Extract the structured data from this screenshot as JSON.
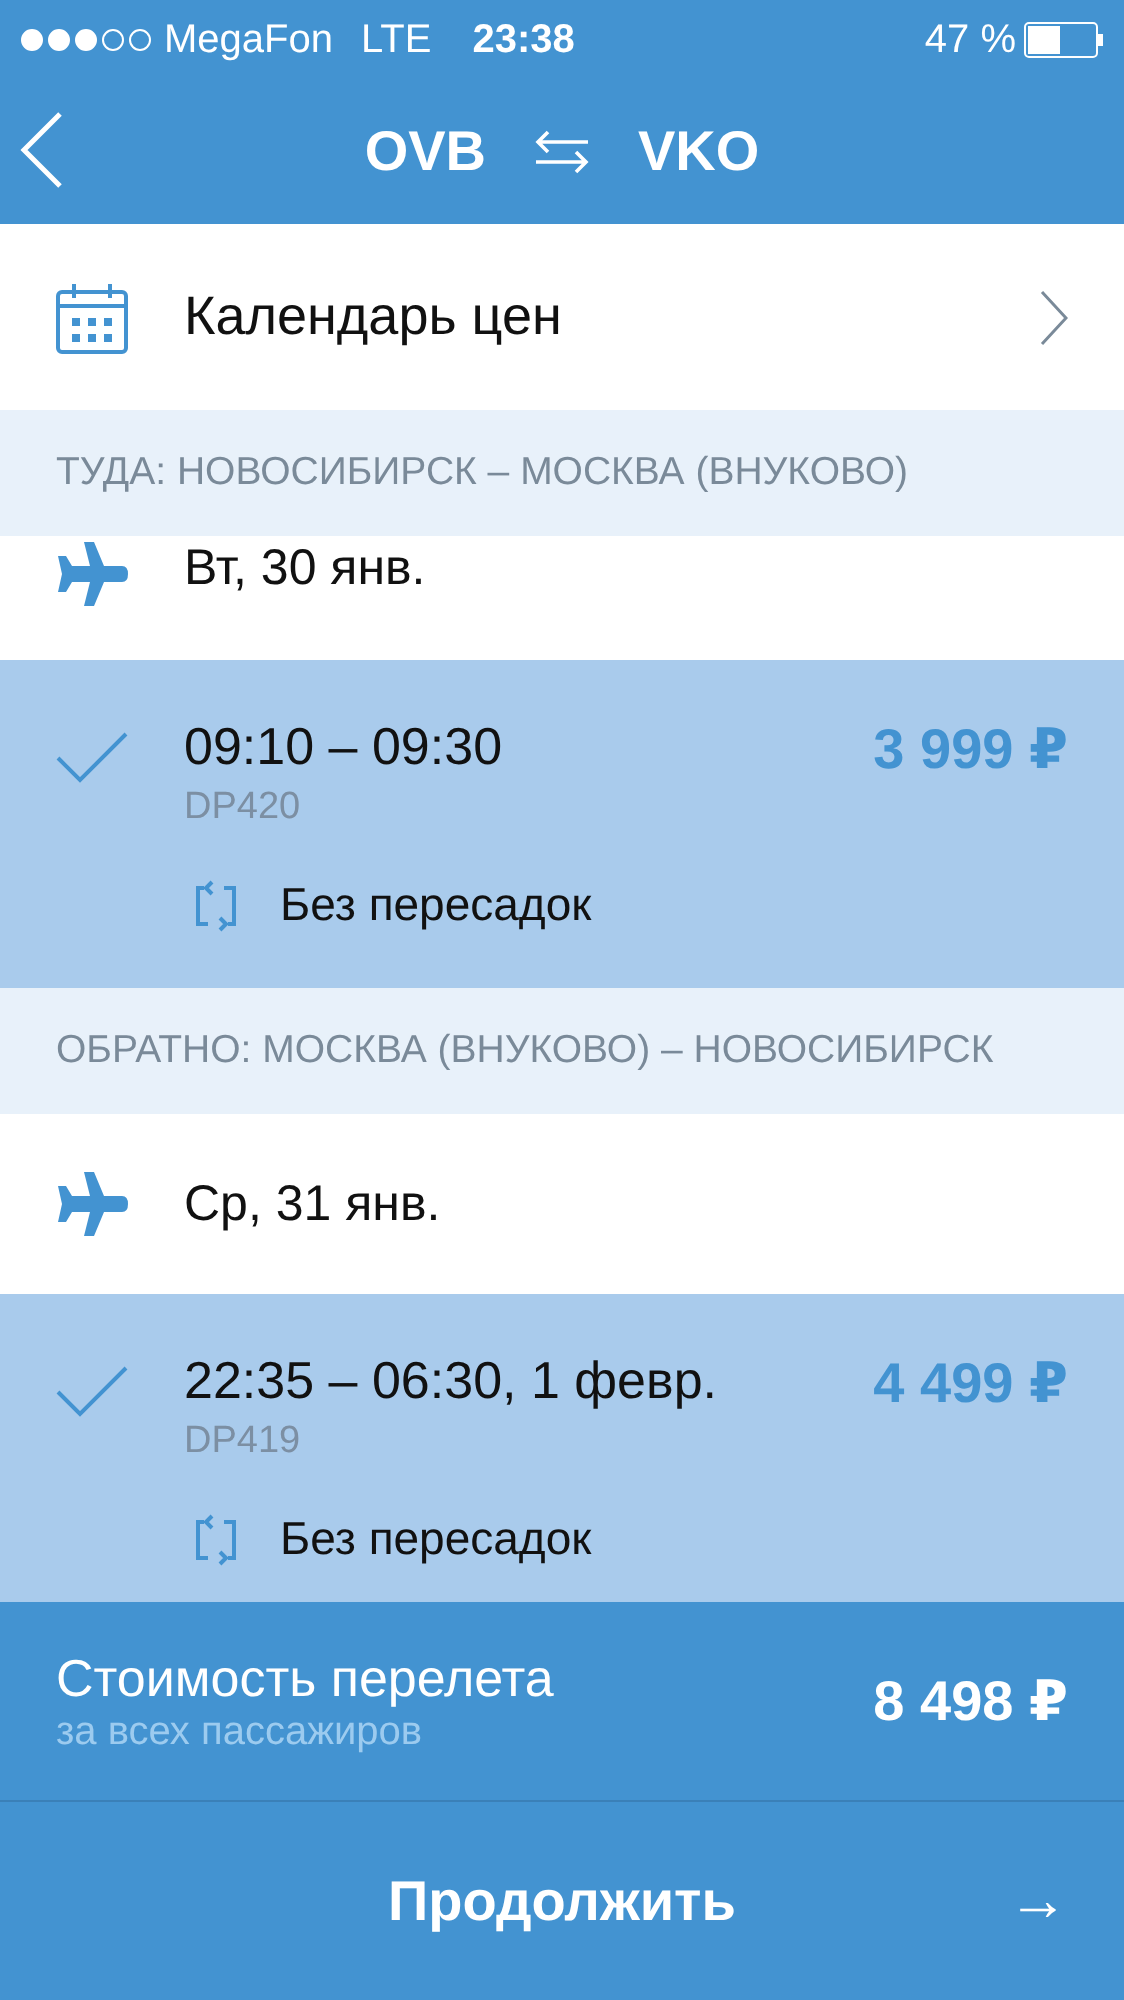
{
  "status_bar": {
    "carrier": "MegaFon",
    "network": "LTE",
    "time": "23:38",
    "battery": "47 %"
  },
  "nav": {
    "from": "OVB",
    "to": "VKO"
  },
  "calendar": {
    "label": "Календарь цен"
  },
  "legs": [
    {
      "header": "ТУДА: НОВОСИБИРСК – МОСКВА (ВНУКОВО)",
      "date": "Вт, 30 янв.",
      "flights": [
        {
          "times": "09:10 – 09:30",
          "number": "DP420",
          "price": "3 999 ₽",
          "stops": "Без пересадок",
          "selected": true
        }
      ]
    },
    {
      "header": "ОБРАТНО: МОСКВА (ВНУКОВО) – НОВОСИБИРСК",
      "date": "Ср, 31 янв.",
      "flights": [
        {
          "times": "22:35 – 06:30, 1 февр.",
          "number": "DP419",
          "price": "4 499 ₽",
          "stops": "Без пересадок",
          "selected": true
        }
      ]
    }
  ],
  "total": {
    "label": "Стоимость перелета",
    "sublabel": "за всех пассажиров",
    "price": "8 498 ₽"
  },
  "continue": {
    "label": "Продолжить",
    "arrow": "→"
  }
}
